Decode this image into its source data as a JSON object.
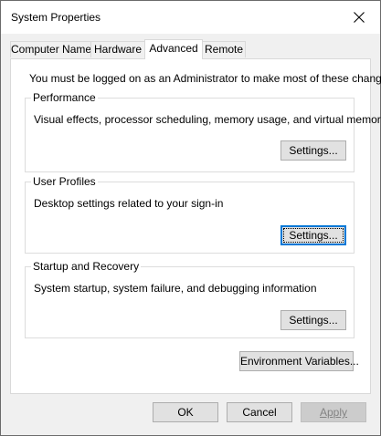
{
  "window": {
    "title": "System Properties"
  },
  "tabs": [
    {
      "label": "Computer Name",
      "selected": false
    },
    {
      "label": "Hardware",
      "selected": false
    },
    {
      "label": "Advanced",
      "selected": true
    },
    {
      "label": "Remote",
      "selected": false
    }
  ],
  "advanced": {
    "admin_note": "You must be logged on as an Administrator to make most of these changes.",
    "performance": {
      "label": "Performance",
      "description": "Visual effects, processor scheduling, memory usage, and virtual memory",
      "button": "Settings..."
    },
    "user_profiles": {
      "label": "User Profiles",
      "description": "Desktop settings related to your sign-in",
      "button": "Settings..."
    },
    "startup_recovery": {
      "label": "Startup and Recovery",
      "description": "System startup, system failure, and debugging information",
      "button": "Settings..."
    },
    "env_button": "Environment Variables..."
  },
  "footer": {
    "ok": "OK",
    "cancel": "Cancel",
    "apply": "Apply"
  },
  "icons": {
    "close": "close-icon"
  },
  "colors": {
    "focus": "#0078d7",
    "disabled_text": "#838383"
  }
}
